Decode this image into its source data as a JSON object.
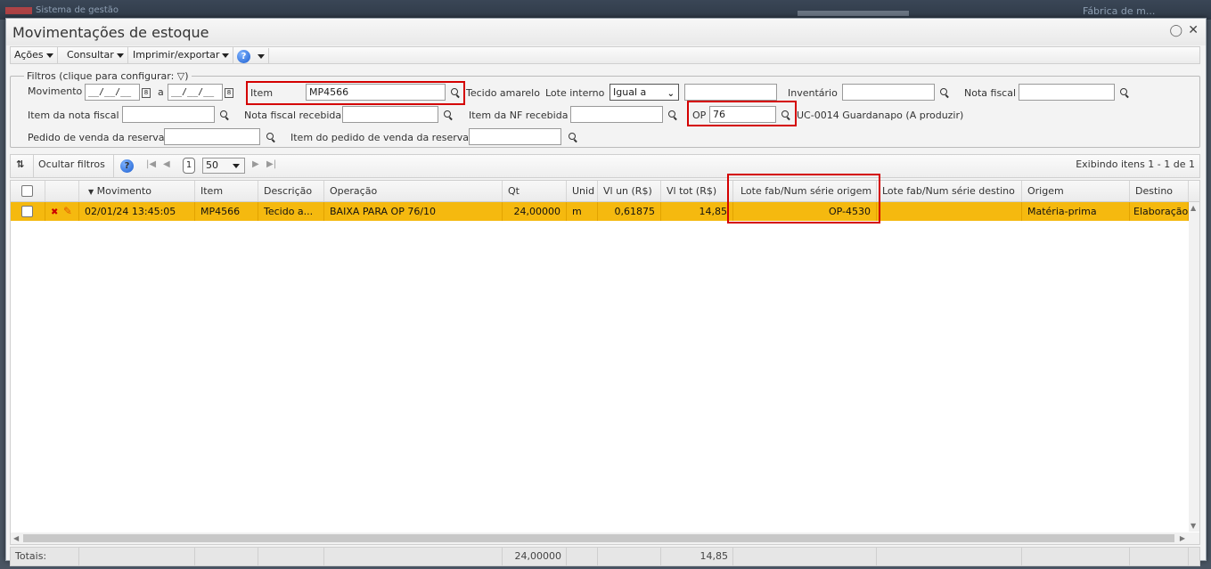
{
  "background": {
    "app_title": "Sistema de gestão",
    "right_text": "Fábrica de m..."
  },
  "window": {
    "title": "Movimentações de estoque"
  },
  "menu": {
    "acoes": "Ações",
    "consultar": "Consultar",
    "imprimir": "Imprimir/exportar",
    "help": "?"
  },
  "filters": {
    "legend": "Filtros (clique para configurar:",
    "legend_end": ")",
    "movimento_label": "Movimento",
    "date_from": "__/__/__",
    "date_sep": "a",
    "date_to": "__/__/__",
    "item_label": "Item",
    "item_value": "MP4566",
    "item_desc": "Tecido amarelo",
    "lote_label": "Lote interno",
    "lote_option": "Igual a",
    "lote_value": "",
    "inventario_label": "Inventário",
    "inventario_value": "",
    "nota_label": "Nota fiscal",
    "nota_value": "",
    "item_nota_label": "Item da nota fiscal",
    "item_nota_value": "",
    "nota_recebida_label": "Nota fiscal recebida",
    "nota_recebida_value": "",
    "item_nf_label": "Item da NF recebida",
    "item_nf_value": "",
    "op_label": "OP",
    "op_value": "76",
    "op_desc": "UC-0014 Guardanapo (A produzir)",
    "pedido_label": "Pedido de venda da reserva",
    "pedido_value": "",
    "item_pedido_label": "Item do pedido de venda da reserva",
    "item_pedido_value": ""
  },
  "toolbar": {
    "hide_filters": "Ocultar filtros",
    "page": "1",
    "page_size": "50",
    "showing": "Exibindo itens 1 - 1 de 1"
  },
  "grid": {
    "headers": {
      "movimento": "Movimento",
      "item": "Item",
      "descricao": "Descrição",
      "operacao": "Operação",
      "qt": "Qt",
      "unid": "Unid",
      "vl_un": "Vl un (R$)",
      "vl_tot": "Vl tot (R$)",
      "lote_origem": "Lote fab/Num série origem",
      "lote_destino": "Lote fab/Num série destino",
      "origem": "Origem",
      "destino": "Destino"
    },
    "rows": [
      {
        "movimento": "02/01/24 13:45:05",
        "item": "MP4566",
        "descricao": "Tecido a...",
        "operacao": "BAIXA PARA OP 76/10",
        "qt": "24,00000",
        "unid": "m",
        "vl_un": "0,61875",
        "vl_tot": "14,85",
        "lote_origem": "OP-4530",
        "lote_destino": "",
        "origem": "Matéria-prima",
        "destino": "Elaboração"
      }
    ]
  },
  "totals": {
    "label": "Totais:",
    "qt": "24,00000",
    "vl_tot": "14,85"
  },
  "colors": {
    "row_highlight": "#f5b90f",
    "annotation": "#d40000",
    "help_blue": "#1c5fd0"
  }
}
